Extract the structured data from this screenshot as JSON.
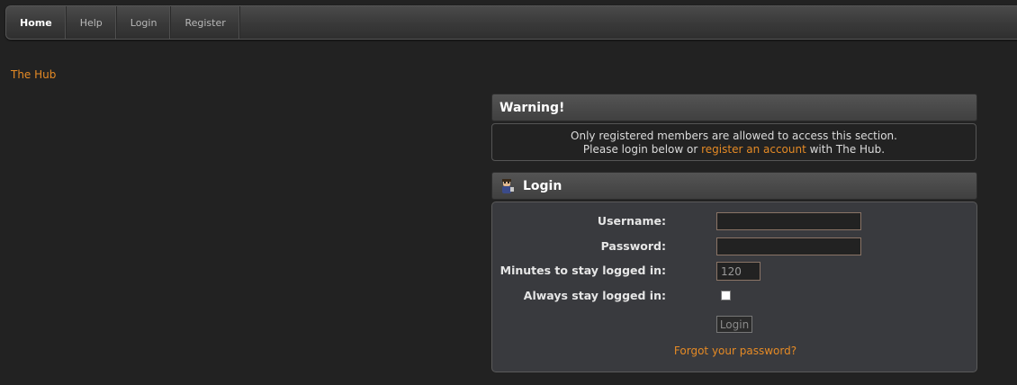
{
  "nav": {
    "items": [
      {
        "label": "Home",
        "active": true
      },
      {
        "label": "Help"
      },
      {
        "label": "Login"
      },
      {
        "label": "Register"
      }
    ]
  },
  "site": {
    "name": "The Hub"
  },
  "warning": {
    "title": "Warning!",
    "line1": "Only registered members are allowed to access this section.",
    "line2_prefix": "Please login below or ",
    "line2_link": "register an account",
    "line2_suffix": " with The Hub."
  },
  "login": {
    "title": "Login",
    "icon": "user-icon",
    "username_label": "Username:",
    "username_value": "",
    "password_label": "Password:",
    "password_value": "",
    "minutes_label": "Minutes to stay logged in:",
    "minutes_value": "120",
    "always_label": "Always stay logged in:",
    "always_checked": false,
    "submit_label": "Login",
    "forgot_label": "Forgot your password?"
  },
  "colors": {
    "accent": "#e58a25",
    "background": "#222222",
    "panel": "#393a3e"
  }
}
